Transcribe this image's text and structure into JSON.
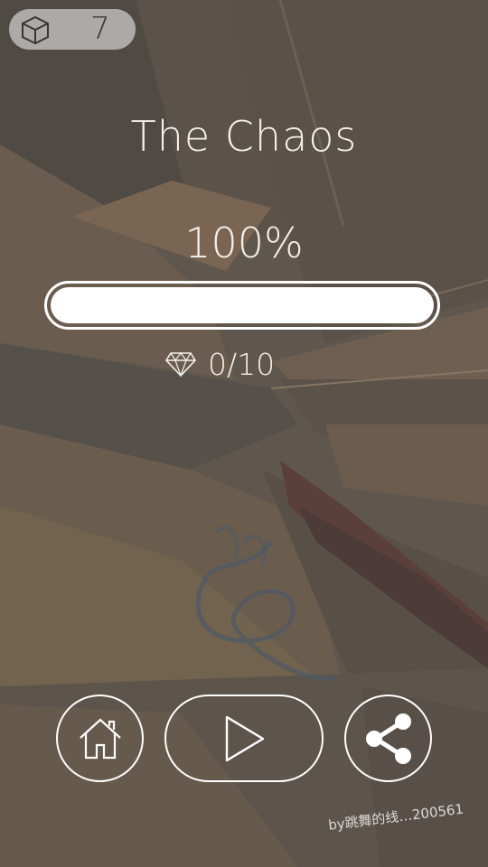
{
  "cube_counter": {
    "icon": "cube-icon",
    "value": "7"
  },
  "level": {
    "title": "The Chaos",
    "percent_label": "100%",
    "progress": 1.0
  },
  "gems": {
    "icon": "diamond-icon",
    "label": "0/10"
  },
  "buttons": {
    "home": "home-icon",
    "play": "play-icon",
    "share": "share-icon"
  },
  "watermark": "by跳舞的线…200561",
  "colors": {
    "background": "#5e554c",
    "text": "#f4f1ec",
    "outline": "#ffffff"
  }
}
